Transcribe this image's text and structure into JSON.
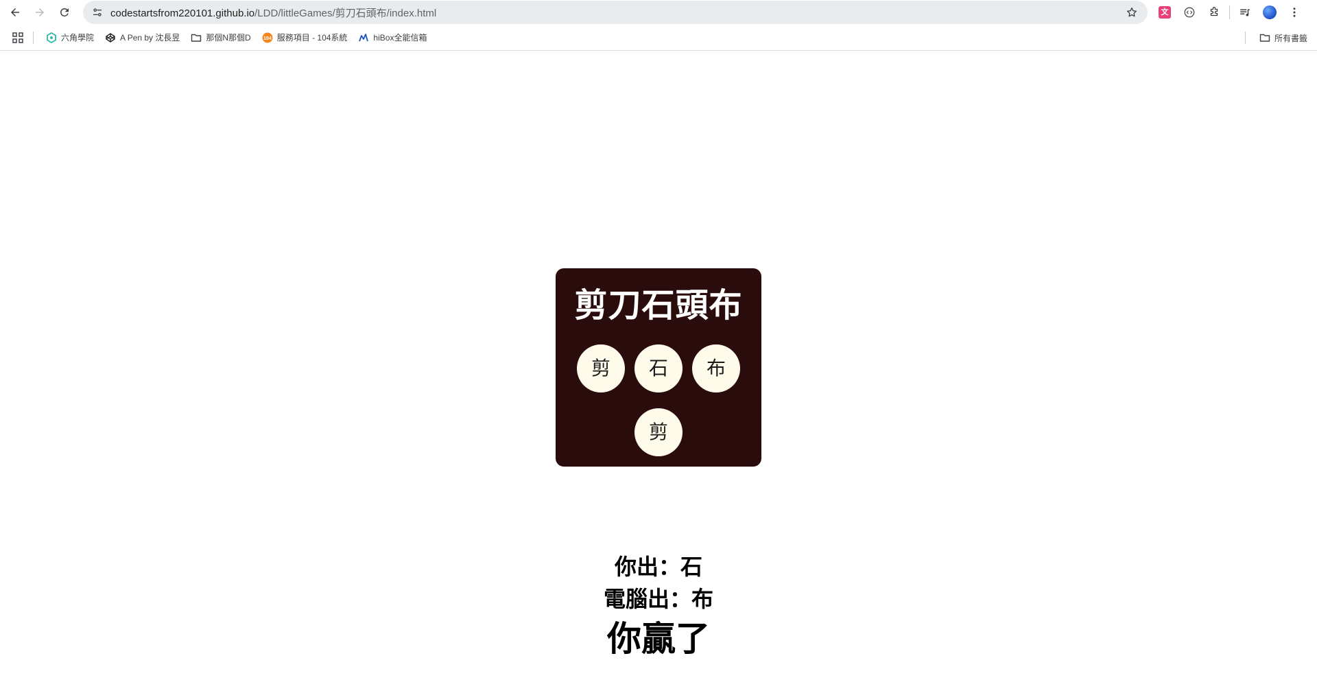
{
  "browser": {
    "url_host": "codestartsfrom220101.github.io",
    "url_path": "/LDD/littleGames/剪刀石頭布/index.html",
    "bookmarks": [
      {
        "label": "六角學院",
        "icon": "hexschool-icon"
      },
      {
        "label": "A Pen by 沈長昱",
        "icon": "codepen-icon"
      },
      {
        "label": "那個N那個D",
        "icon": "folder-icon"
      },
      {
        "label": "服務項目 - 104系統",
        "icon": "104-icon"
      },
      {
        "label": "hiBox全能信箱",
        "icon": "hibox-icon"
      }
    ],
    "all_bookmarks_label": "所有書籤",
    "translate_ext_label": "文"
  },
  "game": {
    "title": "剪刀石頭布",
    "choices": [
      {
        "label": "剪"
      },
      {
        "label": "石"
      },
      {
        "label": "布"
      }
    ],
    "computer_display": "剪"
  },
  "result": {
    "you_line": "你出：石",
    "computer_line": "電腦出：布",
    "outcome": "你贏了"
  }
}
